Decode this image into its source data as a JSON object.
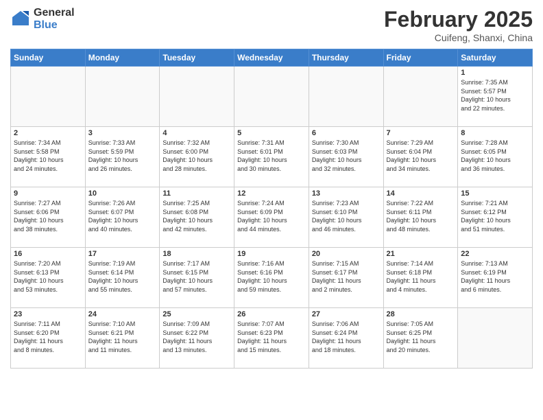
{
  "logo": {
    "general": "General",
    "blue": "Blue"
  },
  "header": {
    "month": "February 2025",
    "location": "Cuifeng, Shanxi, China"
  },
  "days_of_week": [
    "Sunday",
    "Monday",
    "Tuesday",
    "Wednesday",
    "Thursday",
    "Friday",
    "Saturday"
  ],
  "weeks": [
    [
      {
        "day": "",
        "info": ""
      },
      {
        "day": "",
        "info": ""
      },
      {
        "day": "",
        "info": ""
      },
      {
        "day": "",
        "info": ""
      },
      {
        "day": "",
        "info": ""
      },
      {
        "day": "",
        "info": ""
      },
      {
        "day": "1",
        "info": "Sunrise: 7:35 AM\nSunset: 5:57 PM\nDaylight: 10 hours\nand 22 minutes."
      }
    ],
    [
      {
        "day": "2",
        "info": "Sunrise: 7:34 AM\nSunset: 5:58 PM\nDaylight: 10 hours\nand 24 minutes."
      },
      {
        "day": "3",
        "info": "Sunrise: 7:33 AM\nSunset: 5:59 PM\nDaylight: 10 hours\nand 26 minutes."
      },
      {
        "day": "4",
        "info": "Sunrise: 7:32 AM\nSunset: 6:00 PM\nDaylight: 10 hours\nand 28 minutes."
      },
      {
        "day": "5",
        "info": "Sunrise: 7:31 AM\nSunset: 6:01 PM\nDaylight: 10 hours\nand 30 minutes."
      },
      {
        "day": "6",
        "info": "Sunrise: 7:30 AM\nSunset: 6:03 PM\nDaylight: 10 hours\nand 32 minutes."
      },
      {
        "day": "7",
        "info": "Sunrise: 7:29 AM\nSunset: 6:04 PM\nDaylight: 10 hours\nand 34 minutes."
      },
      {
        "day": "8",
        "info": "Sunrise: 7:28 AM\nSunset: 6:05 PM\nDaylight: 10 hours\nand 36 minutes."
      }
    ],
    [
      {
        "day": "9",
        "info": "Sunrise: 7:27 AM\nSunset: 6:06 PM\nDaylight: 10 hours\nand 38 minutes."
      },
      {
        "day": "10",
        "info": "Sunrise: 7:26 AM\nSunset: 6:07 PM\nDaylight: 10 hours\nand 40 minutes."
      },
      {
        "day": "11",
        "info": "Sunrise: 7:25 AM\nSunset: 6:08 PM\nDaylight: 10 hours\nand 42 minutes."
      },
      {
        "day": "12",
        "info": "Sunrise: 7:24 AM\nSunset: 6:09 PM\nDaylight: 10 hours\nand 44 minutes."
      },
      {
        "day": "13",
        "info": "Sunrise: 7:23 AM\nSunset: 6:10 PM\nDaylight: 10 hours\nand 46 minutes."
      },
      {
        "day": "14",
        "info": "Sunrise: 7:22 AM\nSunset: 6:11 PM\nDaylight: 10 hours\nand 48 minutes."
      },
      {
        "day": "15",
        "info": "Sunrise: 7:21 AM\nSunset: 6:12 PM\nDaylight: 10 hours\nand 51 minutes."
      }
    ],
    [
      {
        "day": "16",
        "info": "Sunrise: 7:20 AM\nSunset: 6:13 PM\nDaylight: 10 hours\nand 53 minutes."
      },
      {
        "day": "17",
        "info": "Sunrise: 7:19 AM\nSunset: 6:14 PM\nDaylight: 10 hours\nand 55 minutes."
      },
      {
        "day": "18",
        "info": "Sunrise: 7:17 AM\nSunset: 6:15 PM\nDaylight: 10 hours\nand 57 minutes."
      },
      {
        "day": "19",
        "info": "Sunrise: 7:16 AM\nSunset: 6:16 PM\nDaylight: 10 hours\nand 59 minutes."
      },
      {
        "day": "20",
        "info": "Sunrise: 7:15 AM\nSunset: 6:17 PM\nDaylight: 11 hours\nand 2 minutes."
      },
      {
        "day": "21",
        "info": "Sunrise: 7:14 AM\nSunset: 6:18 PM\nDaylight: 11 hours\nand 4 minutes."
      },
      {
        "day": "22",
        "info": "Sunrise: 7:13 AM\nSunset: 6:19 PM\nDaylight: 11 hours\nand 6 minutes."
      }
    ],
    [
      {
        "day": "23",
        "info": "Sunrise: 7:11 AM\nSunset: 6:20 PM\nDaylight: 11 hours\nand 8 minutes."
      },
      {
        "day": "24",
        "info": "Sunrise: 7:10 AM\nSunset: 6:21 PM\nDaylight: 11 hours\nand 11 minutes."
      },
      {
        "day": "25",
        "info": "Sunrise: 7:09 AM\nSunset: 6:22 PM\nDaylight: 11 hours\nand 13 minutes."
      },
      {
        "day": "26",
        "info": "Sunrise: 7:07 AM\nSunset: 6:23 PM\nDaylight: 11 hours\nand 15 minutes."
      },
      {
        "day": "27",
        "info": "Sunrise: 7:06 AM\nSunset: 6:24 PM\nDaylight: 11 hours\nand 18 minutes."
      },
      {
        "day": "28",
        "info": "Sunrise: 7:05 AM\nSunset: 6:25 PM\nDaylight: 11 hours\nand 20 minutes."
      },
      {
        "day": "",
        "info": ""
      }
    ]
  ]
}
